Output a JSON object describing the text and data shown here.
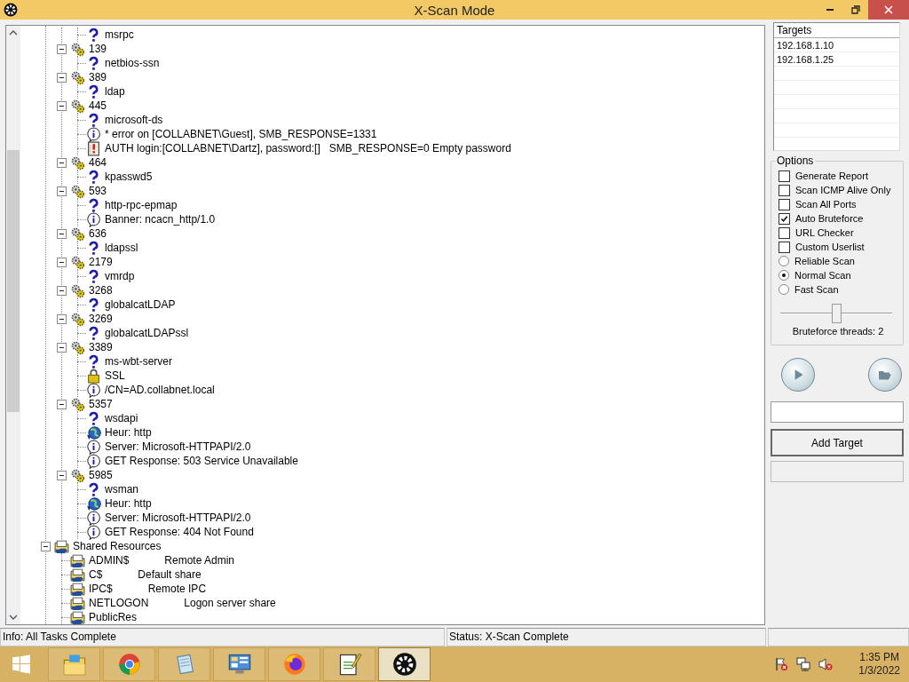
{
  "window": {
    "title": "X-Scan Mode"
  },
  "tree": {
    "items": [
      {
        "children": [
          {
            "children": [
              {
                "kind": "service",
                "text": "msrpc"
              }
            ]
          },
          {
            "kind": "port",
            "text": "139",
            "expanded": true,
            "children": [
              {
                "kind": "service",
                "text": "netbios-ssn"
              }
            ]
          },
          {
            "kind": "port",
            "text": "389",
            "expanded": true,
            "children": [
              {
                "kind": "service",
                "text": "ldap"
              }
            ]
          },
          {
            "kind": "port",
            "text": "445",
            "expanded": true,
            "children": [
              {
                "kind": "service",
                "text": "microsoft-ds"
              },
              {
                "kind": "info",
                "text": "* error on [COLLABNET\\Guest], SMB_RESPONSE=1331"
              },
              {
                "kind": "alert",
                "text": "AUTH login:[COLLABNET\\Dartz], password:[]   SMB_RESPONSE=0 Empty password"
              }
            ]
          },
          {
            "kind": "port",
            "text": "464",
            "expanded": true,
            "children": [
              {
                "kind": "service",
                "text": "kpasswd5"
              }
            ]
          },
          {
            "kind": "port",
            "text": "593",
            "expanded": true,
            "children": [
              {
                "kind": "service",
                "text": "http-rpc-epmap"
              },
              {
                "kind": "info",
                "text": "Banner: ncacn_http/1.0"
              }
            ]
          },
          {
            "kind": "port",
            "text": "636",
            "expanded": true,
            "children": [
              {
                "kind": "service",
                "text": "ldapssl"
              }
            ]
          },
          {
            "kind": "port",
            "text": "2179",
            "expanded": true,
            "children": [
              {
                "kind": "service",
                "text": "vmrdp"
              }
            ]
          },
          {
            "kind": "port",
            "text": "3268",
            "expanded": true,
            "children": [
              {
                "kind": "service",
                "text": "globalcatLDAP"
              }
            ]
          },
          {
            "kind": "port",
            "text": "3269",
            "expanded": true,
            "children": [
              {
                "kind": "service",
                "text": "globalcatLDAPssl"
              }
            ]
          },
          {
            "kind": "port",
            "text": "3389",
            "expanded": true,
            "children": [
              {
                "kind": "service",
                "text": "ms-wbt-server"
              },
              {
                "kind": "lock",
                "text": "SSL"
              },
              {
                "kind": "info",
                "text": "/CN=AD.collabnet.local"
              }
            ]
          },
          {
            "kind": "port",
            "text": "5357",
            "expanded": true,
            "children": [
              {
                "kind": "service",
                "text": "wsdapi"
              },
              {
                "kind": "web",
                "text": "Heur: http"
              },
              {
                "kind": "info",
                "text": "Server: Microsoft-HTTPAPI/2.0"
              },
              {
                "kind": "info",
                "text": "GET Response: 503 Service Unavailable"
              }
            ]
          },
          {
            "kind": "port",
            "text": "5985",
            "expanded": true,
            "children": [
              {
                "kind": "service",
                "text": "wsman"
              },
              {
                "kind": "web",
                "text": "Heur: http"
              },
              {
                "kind": "info",
                "text": "Server: Microsoft-HTTPAPI/2.0"
              },
              {
                "kind": "info",
                "text": "GET Response: 404 Not Found"
              }
            ]
          }
        ]
      },
      {
        "kind": "shares",
        "text": "Shared Resources",
        "expanded": true,
        "children": [
          {
            "kind": "share",
            "text": "ADMIN$",
            "description": "Remote Admin"
          },
          {
            "kind": "share",
            "text": "C$",
            "description": "Default share"
          },
          {
            "kind": "share",
            "text": "IPC$",
            "description": "Remote IPC"
          },
          {
            "kind": "share",
            "text": "NETLOGON",
            "description": "Logon server share"
          },
          {
            "kind": "share",
            "text": "PublicRes"
          }
        ]
      }
    ]
  },
  "targets": {
    "header": "Targets",
    "rows": [
      "192.168.1.10",
      "192.168.1.25"
    ]
  },
  "options": {
    "title": "Options",
    "items": [
      {
        "kind": "checkbox",
        "label": "Generate Report",
        "checked": false
      },
      {
        "kind": "checkbox",
        "label": "Scan ICMP Alive Only",
        "checked": false
      },
      {
        "kind": "checkbox",
        "label": "Scan All Ports",
        "checked": false
      },
      {
        "kind": "checkbox",
        "label": "Auto Bruteforce",
        "checked": true
      },
      {
        "kind": "checkbox",
        "label": "URL Checker",
        "checked": false
      },
      {
        "kind": "checkbox",
        "label": "Custom Userlist",
        "checked": false
      },
      {
        "kind": "radio",
        "label": "Reliable Scan",
        "selected": false
      },
      {
        "kind": "radio",
        "label": "Normal Scan",
        "selected": true
      },
      {
        "kind": "radio",
        "label": "Fast Scan",
        "selected": false
      }
    ],
    "slider": {
      "level": 0.5,
      "label": "Bruteforce threads: 2"
    }
  },
  "add_button": "Add Target",
  "status_bar": [
    "Info: All Tasks Complete",
    "Status: X-Scan Complete"
  ],
  "taskbar": {
    "apps": [
      {
        "kind": "explorer",
        "selected": false
      },
      {
        "kind": "chrome",
        "selected": false
      },
      {
        "kind": "notepad",
        "selected": false
      },
      {
        "kind": "control",
        "selected": false
      },
      {
        "kind": "firefox",
        "selected": false
      },
      {
        "kind": "notepadpp",
        "selected": false
      },
      {
        "kind": "xscan",
        "selected": true
      }
    ],
    "time": "1:35 PM",
    "date": "1/3/2022"
  }
}
